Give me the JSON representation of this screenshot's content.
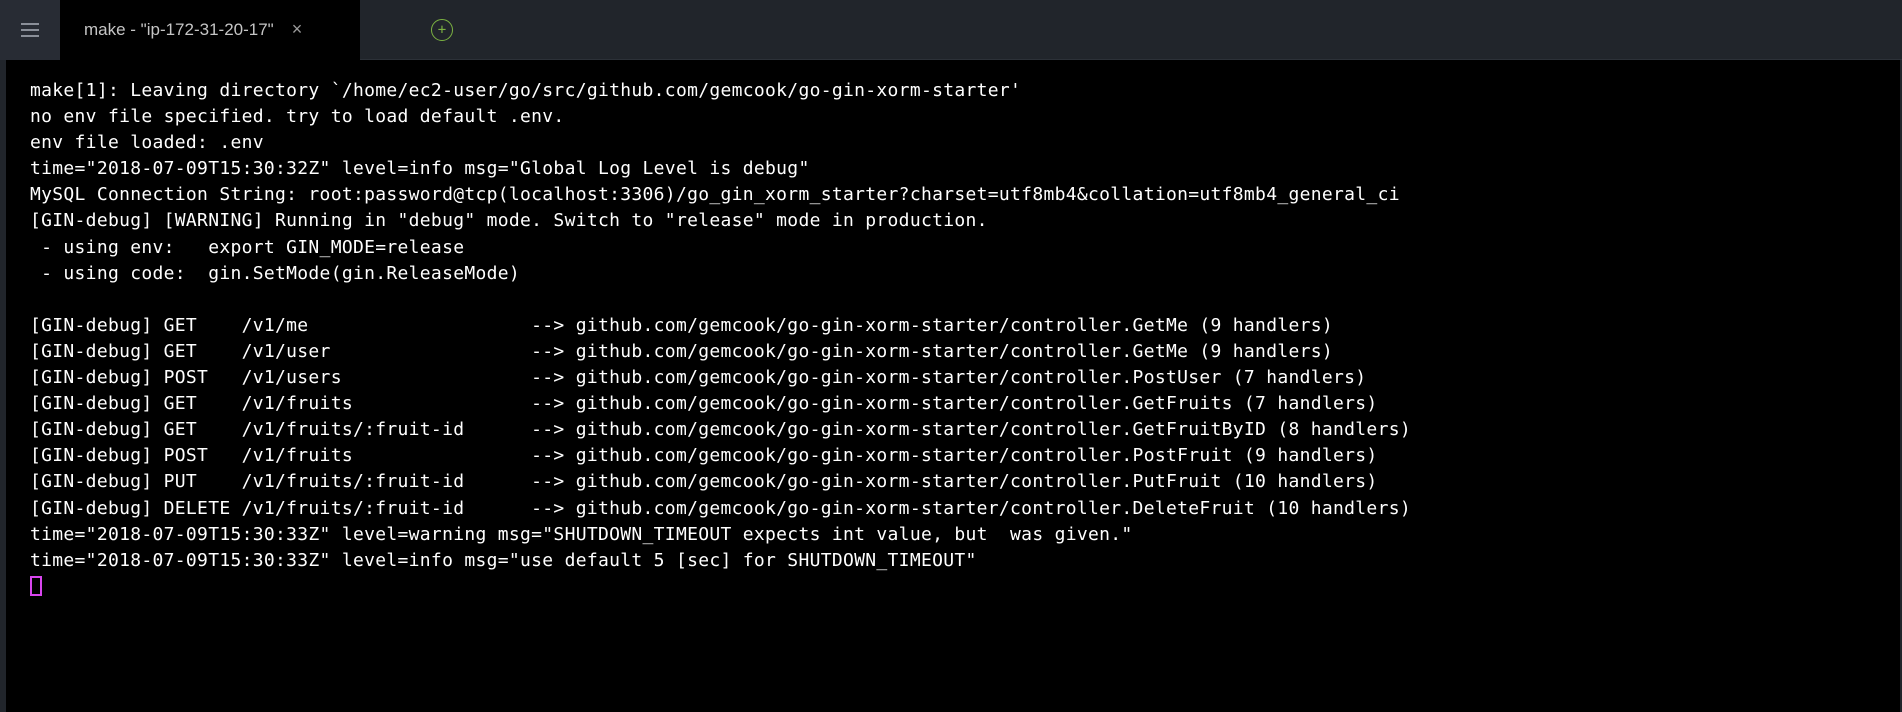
{
  "tab": {
    "title": "make - \"ip-172-31-20-17\"",
    "close_label": "×"
  },
  "terminal": {
    "lines": [
      "make[1]: Leaving directory `/home/ec2-user/go/src/github.com/gemcook/go-gin-xorm-starter'",
      "no env file specified. try to load default .env.",
      "env file loaded: .env",
      "time=\"2018-07-09T15:30:32Z\" level=info msg=\"Global Log Level is debug\"",
      "MySQL Connection String: root:password@tcp(localhost:3306)/go_gin_xorm_starter?charset=utf8mb4&collation=utf8mb4_general_ci",
      "[GIN-debug] [WARNING] Running in \"debug\" mode. Switch to \"release\" mode in production.",
      " - using env:   export GIN_MODE=release",
      " - using code:  gin.SetMode(gin.ReleaseMode)",
      "",
      "[GIN-debug] GET    /v1/me                    --> github.com/gemcook/go-gin-xorm-starter/controller.GetMe (9 handlers)",
      "[GIN-debug] GET    /v1/user                  --> github.com/gemcook/go-gin-xorm-starter/controller.GetMe (9 handlers)",
      "[GIN-debug] POST   /v1/users                 --> github.com/gemcook/go-gin-xorm-starter/controller.PostUser (7 handlers)",
      "[GIN-debug] GET    /v1/fruits                --> github.com/gemcook/go-gin-xorm-starter/controller.GetFruits (7 handlers)",
      "[GIN-debug] GET    /v1/fruits/:fruit-id      --> github.com/gemcook/go-gin-xorm-starter/controller.GetFruitByID (8 handlers)",
      "[GIN-debug] POST   /v1/fruits                --> github.com/gemcook/go-gin-xorm-starter/controller.PostFruit (9 handlers)",
      "[GIN-debug] PUT    /v1/fruits/:fruit-id      --> github.com/gemcook/go-gin-xorm-starter/controller.PutFruit (10 handlers)",
      "[GIN-debug] DELETE /v1/fruits/:fruit-id      --> github.com/gemcook/go-gin-xorm-starter/controller.DeleteFruit (10 handlers)",
      "time=\"2018-07-09T15:30:33Z\" level=warning msg=\"SHUTDOWN_TIMEOUT expects int value, but  was given.\"",
      "time=\"2018-07-09T15:30:33Z\" level=info msg=\"use default 5 [sec] for SHUTDOWN_TIMEOUT\""
    ]
  }
}
